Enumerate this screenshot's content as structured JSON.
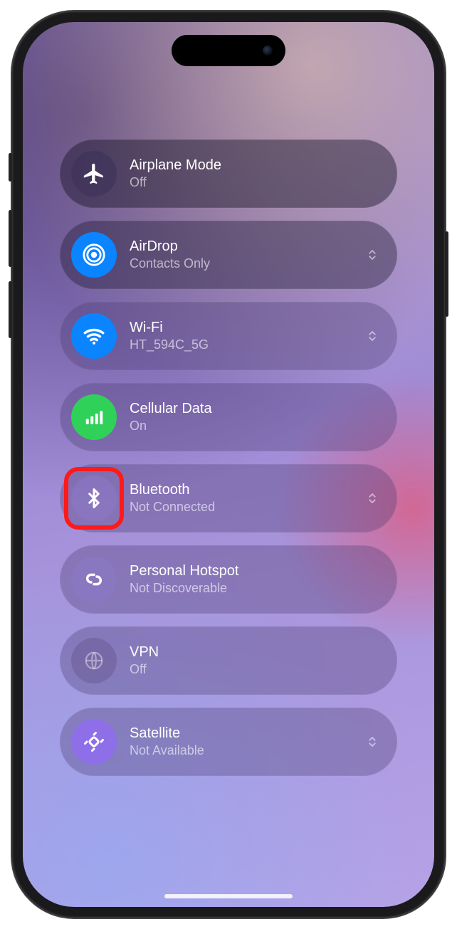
{
  "tiles": [
    {
      "id": "airplane",
      "title": "Airplane Mode",
      "status": "Off",
      "icon_bg": "rgba(60,50,90,0.6)",
      "chevron": false
    },
    {
      "id": "airdrop",
      "title": "AirDrop",
      "status": "Contacts Only",
      "icon_bg": "#0a84ff",
      "chevron": true
    },
    {
      "id": "wifi",
      "title": "Wi-Fi",
      "status": "HT_594C_5G",
      "icon_bg": "#0a84ff",
      "chevron": true
    },
    {
      "id": "cellular",
      "title": "Cellular Data",
      "status": "On",
      "icon_bg": "#30d158",
      "chevron": false
    },
    {
      "id": "bluetooth",
      "title": "Bluetooth",
      "status": "Not Connected",
      "icon_bg": "rgba(140,120,200,0.55)",
      "chevron": true,
      "highlight": true
    },
    {
      "id": "hotspot",
      "title": "Personal Hotspot",
      "status": "Not Discoverable",
      "icon_bg": "rgba(140,120,200,0.55)",
      "chevron": false
    },
    {
      "id": "vpn",
      "title": "VPN",
      "status": "Off",
      "icon_bg": "rgba(90,75,130,0.35)",
      "chevron": false
    },
    {
      "id": "satellite",
      "title": "Satellite",
      "status": "Not Available",
      "icon_bg": "#8e6fe8",
      "chevron": true
    }
  ]
}
